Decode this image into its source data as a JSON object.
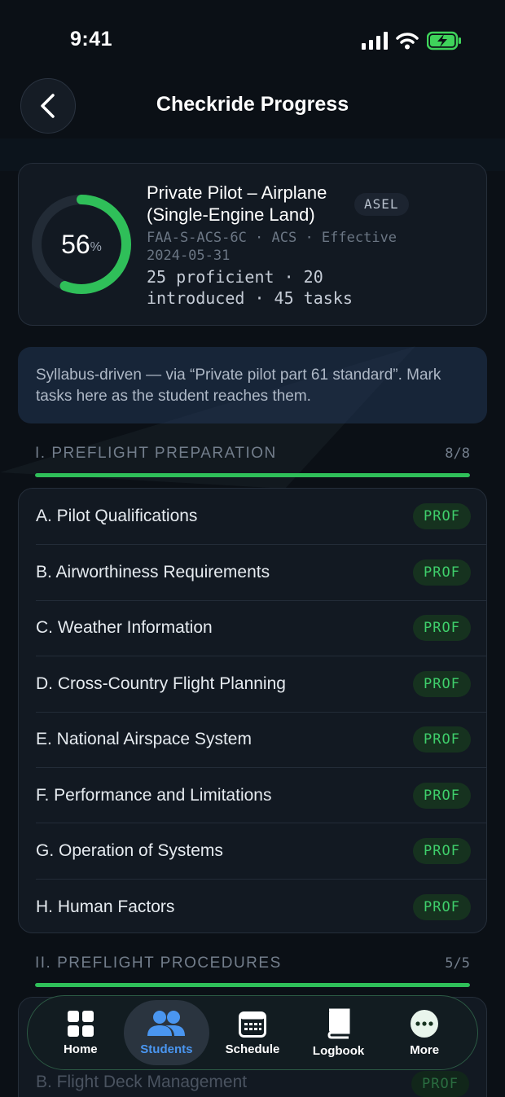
{
  "status_bar": {
    "time": "9:41"
  },
  "header": {
    "title": "Checkride Progress"
  },
  "summary": {
    "percent": "56",
    "percent_sign": "%",
    "progress_fraction": 0.56,
    "title": "Private Pilot – Airplane (Single-Engine Land)",
    "badge": "ASEL",
    "meta": "FAA-S-ACS-6C · ACS · Effective 2024-05-31",
    "stats": "25 proficient · 20 introduced · 45 tasks"
  },
  "banner": {
    "text": "Syllabus-driven — via “Private pilot part 61 standard”. Mark tasks here as the student reaches them."
  },
  "sections": [
    {
      "name": "I. PREFLIGHT PREPARATION",
      "count": "8/8",
      "progress_fraction": 1.0,
      "tasks": [
        {
          "label": "A. Pilot Qualifications",
          "status": "PROF"
        },
        {
          "label": "B. Airworthiness Requirements",
          "status": "PROF"
        },
        {
          "label": "C. Weather Information",
          "status": "PROF"
        },
        {
          "label": "D. Cross-Country Flight Planning",
          "status": "PROF"
        },
        {
          "label": "E. National Airspace System",
          "status": "PROF"
        },
        {
          "label": "F. Performance and Limitations",
          "status": "PROF"
        },
        {
          "label": "G. Operation of Systems",
          "status": "PROF"
        },
        {
          "label": "H. Human Factors",
          "status": "PROF"
        }
      ]
    },
    {
      "name": "II. PREFLIGHT PROCEDURES",
      "count": "5/5",
      "progress_fraction": 1.0,
      "tasks": [
        {
          "label": "B. Flight Deck Management",
          "status": "PROF"
        }
      ]
    }
  ],
  "tabbar": {
    "tabs": [
      {
        "label": "Home",
        "icon": "grid-icon"
      },
      {
        "label": "Students",
        "icon": "people-icon",
        "active": true
      },
      {
        "label": "Schedule",
        "icon": "calendar-icon"
      },
      {
        "label": "Logbook",
        "icon": "book-icon"
      },
      {
        "label": "More",
        "icon": "more-icon"
      }
    ]
  },
  "colors": {
    "accent_green": "#2fbf59",
    "accent_blue": "#4a96f0",
    "background": "#0b1016"
  }
}
